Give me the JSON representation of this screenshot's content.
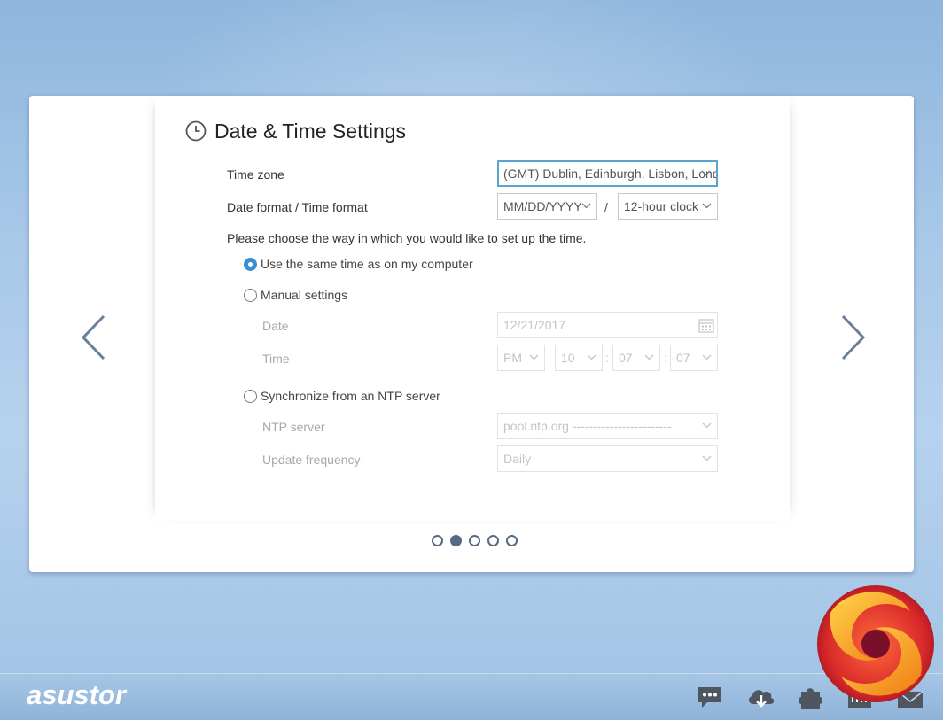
{
  "header": {
    "title": "Date & Time Settings"
  },
  "fields": {
    "timezone": {
      "label": "Time zone",
      "value": "(GMT) Dublin, Edinburgh, Lisbon, London"
    },
    "date_time_format": {
      "label": "Date format / Time format",
      "date_value": "MM/DD/YYYY",
      "separator": "/",
      "time_value": "12-hour clock"
    }
  },
  "instruction": "Please choose the way in which you would like to set up the time.",
  "options": {
    "same_time": {
      "label": "Use the same time as on my computer",
      "selected": true
    },
    "manual": {
      "label": "Manual settings",
      "selected": false
    },
    "ntp": {
      "label": "Synchronize from an NTP server",
      "selected": false
    }
  },
  "manual": {
    "date_label": "Date",
    "date_value": "12/21/2017",
    "time_label": "Time",
    "ampm": "PM",
    "hour": "10",
    "minute": "07",
    "second": "07",
    "colon": ":"
  },
  "ntp": {
    "server_label": "NTP server",
    "server_value": "pool.ntp.org ------------------------",
    "freq_label": "Update frequency",
    "freq_value": "Daily"
  },
  "pagination": {
    "total": 5,
    "current": 2
  },
  "taskbar": {
    "logo": "asustor",
    "icons": [
      "chat-icon",
      "cloud-download-icon",
      "plugin-icon",
      "network-icon",
      "mail-icon"
    ]
  },
  "colors": {
    "accent": "#3a8fd4",
    "focus_border": "#5aa4cf",
    "dot": "#556b82",
    "arrow": "#6a7f99"
  }
}
